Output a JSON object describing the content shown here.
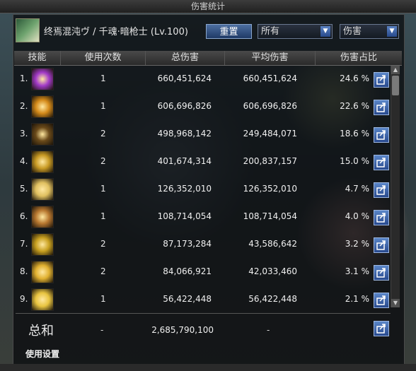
{
  "window": {
    "title": "伤害统计"
  },
  "character": {
    "name": "终焉混沌ヴ / 千魂·暗枪士 (Lv.100)"
  },
  "controls": {
    "reset_label": "重置",
    "filter_select": "所有",
    "metric_select": "伤害"
  },
  "columns": {
    "skill": "技能",
    "uses": "使用次数",
    "total": "总伤害",
    "average": "平均伤害",
    "share": "伤害占比"
  },
  "rows": [
    {
      "rank": "1.",
      "uses": "1",
      "total": "660,451,624",
      "average": "660,451,624",
      "percent": "24.6 %",
      "icon_color": "#a23ac8"
    },
    {
      "rank": "2.",
      "uses": "1",
      "total": "606,696,826",
      "average": "606,696,826",
      "percent": "22.6 %",
      "icon_color": "#d48a1a"
    },
    {
      "rank": "3.",
      "uses": "2",
      "total": "498,968,142",
      "average": "249,484,071",
      "percent": "18.6 %",
      "icon_color": "#6a4a1a"
    },
    {
      "rank": "4.",
      "uses": "2",
      "total": "401,674,314",
      "average": "200,837,157",
      "percent": "15.0 %",
      "icon_color": "#c89a24"
    },
    {
      "rank": "5.",
      "uses": "1",
      "total": "126,352,010",
      "average": "126,352,010",
      "percent": "4.7 %",
      "icon_color": "#e0c060"
    },
    {
      "rank": "6.",
      "uses": "1",
      "total": "108,714,054",
      "average": "108,714,054",
      "percent": "4.0 %",
      "icon_color": "#b87830"
    },
    {
      "rank": "7.",
      "uses": "2",
      "total": "87,173,284",
      "average": "43,586,642",
      "percent": "3.2 %",
      "icon_color": "#c8a020"
    },
    {
      "rank": "8.",
      "uses": "2",
      "total": "84,066,921",
      "average": "42,033,460",
      "percent": "3.1 %",
      "icon_color": "#e0b030"
    },
    {
      "rank": "9.",
      "uses": "1",
      "total": "56,422,448",
      "average": "56,422,448",
      "percent": "2.1 %",
      "icon_color": "#e8c440"
    }
  ],
  "totals": {
    "label": "总和",
    "uses": "-",
    "total": "2,685,790,100",
    "average": "-"
  },
  "footer": {
    "settings_label": "使用设置"
  }
}
